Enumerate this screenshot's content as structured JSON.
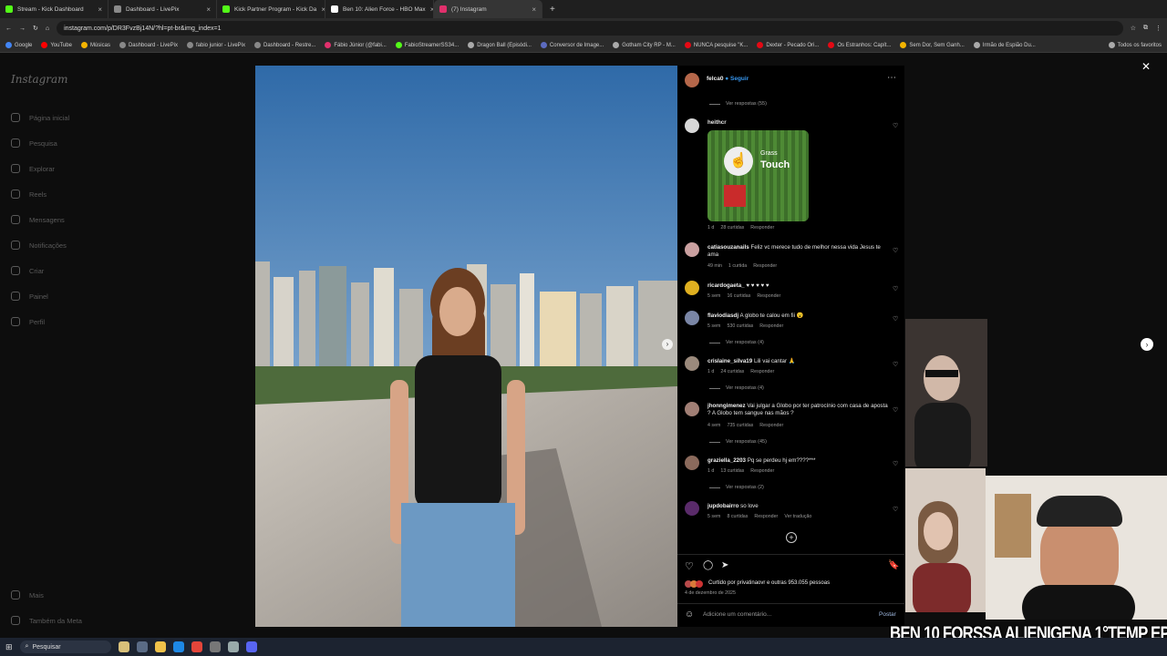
{
  "browser": {
    "tabs": [
      {
        "label": "Stream - Kick Dashboard",
        "color": "#53fc18"
      },
      {
        "label": "Dashboard - LivePix",
        "color": "#8a8a8a"
      },
      {
        "label": "Kick Partner Program - Kick Da",
        "color": "#53fc18"
      },
      {
        "label": "Ben 10: Alien Force - HBO Max",
        "color": "#ffffff"
      },
      {
        "label": "(7) Instagram",
        "color": "#e1306c",
        "active": true
      }
    ],
    "url": "instagram.com/p/DR3FvzBj14N/?hl=pt-br&img_index=1",
    "bookmarks": [
      "Google",
      "YouTube",
      "Músicas",
      "Dashboard - LivePix",
      "fabio junior - LivePix",
      "Dashboard - Restre...",
      "Fábio Júnior (@fabi...",
      "FabioStreamerSS34...",
      "Dragon Ball (Episódi...",
      "Conversor de Image...",
      "Gotham City RP - M...",
      "NUNCA pesquise \"K...",
      "Dexter - Pecado Ori...",
      "Os Estranhos: Capít...",
      "Sem Dor, Sem Ganh...",
      "Irmão de Espião Du...",
      "Todos os favoritos"
    ]
  },
  "sidebar": {
    "logo": "Instagram",
    "items": [
      "Página inicial",
      "Pesquisa",
      "Explorar",
      "Reels",
      "Mensagens",
      "Notificações",
      "Criar",
      "Painel",
      "Perfil"
    ],
    "bottom": [
      "Mais",
      "Também da Meta"
    ]
  },
  "post": {
    "author": "felca0",
    "follow": "Seguir",
    "top_replies": "Ver respostas (55)",
    "sticker": {
      "line1": "Grass",
      "line2": "Touch"
    },
    "comments": [
      {
        "user": "heithcr",
        "text": "",
        "time": "1 d",
        "likes": "28 curtidas",
        "reply": "Responder"
      },
      {
        "user": "catiasouzanails",
        "text": "Feliz vc merece tudo de melhor nessa vida Jesus te ama",
        "time": "49 min",
        "likes": "1 curtida",
        "reply": "Responder"
      },
      {
        "user": "ricardogaeta_",
        "text": "♥ ♥ ♥ ♥ ♥",
        "time": "5 sem",
        "likes": "16 curtidas",
        "reply": "Responder"
      },
      {
        "user": "flaviodiasdj",
        "text": "A globo te calou em fii 😮",
        "time": "5 sem",
        "likes": "530 curtidas",
        "reply": "Responder",
        "replies": "Ver respostas (4)"
      },
      {
        "user": "crislaine_silva19",
        "text": "Lili vai cantar 🙏",
        "time": "1 d",
        "likes": "24 curtidas",
        "reply": "Responder",
        "replies": "Ver respostas (4)"
      },
      {
        "user": "jhonngimenez",
        "text": "Vai julgar a Globo por ter patrocínio com casa de aposta ? A Globo tem sangue nas mãos ?",
        "time": "4 sem",
        "likes": "735 curtidas",
        "reply": "Responder",
        "replies": "Ver respostas (45)"
      },
      {
        "user": "graziella_2203",
        "text": "Pq se perdeu hj em????***",
        "time": "1 d",
        "likes": "13 curtidas",
        "reply": "Responder",
        "replies": "Ver respostas (2)"
      },
      {
        "user": "jupdobairro",
        "text": "so love",
        "time": "5 sem",
        "likes": "8 curtidas",
        "reply": "Responder",
        "translate": "Ver tradução"
      }
    ],
    "liked_by": "Curtido por privatinaovr e outras 953.055 pessoas",
    "date": "4 de dezembro de 2025",
    "add_comment_placeholder": "Adicione um comentário...",
    "post_button": "Postar"
  },
  "overlay": {
    "caption": "BEN 10 FORSSA ALIENIGENA 1°TEMP EP 09"
  },
  "taskbar": {
    "search": "Pesquisar"
  }
}
